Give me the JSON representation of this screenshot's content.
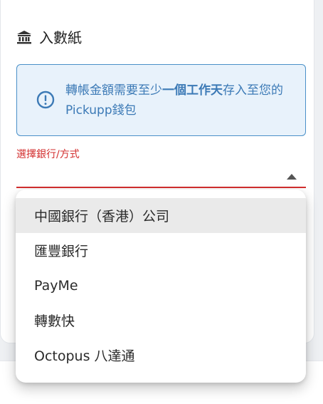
{
  "section": {
    "title": "入數紙",
    "icon": "bank-icon"
  },
  "notice": {
    "icon": "exclamation-circle-icon",
    "text_before": "轉帳金額需要至少",
    "text_bold": "一個工作天",
    "text_after": "存入至您的Pickupp錢包",
    "color": "#3c7ab6",
    "background": "#e8f2fb"
  },
  "bank_select": {
    "label": "選擇銀行/方式",
    "label_color": "#d32f2f",
    "value": "",
    "options": [
      "中國銀行（香港）公司",
      "匯豐銀行",
      "PayMe",
      "轉數快",
      "Octopus 八達通"
    ],
    "highlighted_index": 0
  }
}
